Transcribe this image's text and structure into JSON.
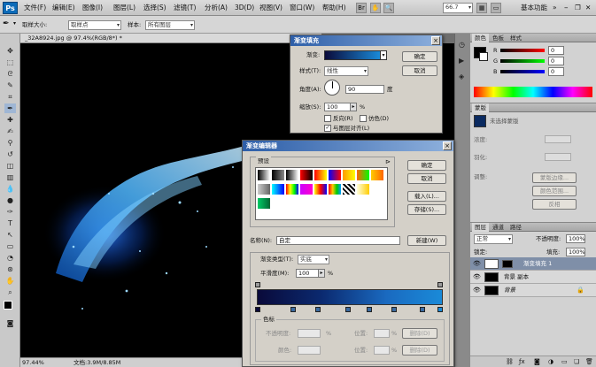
{
  "app": {
    "logo": "Ps"
  },
  "menubar": {
    "items": [
      "文件(F)",
      "编辑(E)",
      "图像(I)",
      "图层(L)",
      "选择(S)",
      "滤镜(T)",
      "分析(A)",
      "3D(D)",
      "视图(V)",
      "窗口(W)",
      "帮助(H)"
    ],
    "zoom": "66.7",
    "workspace": "基本功能"
  },
  "options": {
    "sample_size_label": "取样大小:",
    "sample_size_value": "取样点",
    "sample_label": "样本:",
    "sample_value": "所有图层"
  },
  "document": {
    "tab_title": "_32A8924.jpg @ 97.4%(RGB/8*) *",
    "status_zoom": "97.44%",
    "status_doc": "文档:3.9M/8.85M"
  },
  "gradient_fill": {
    "title": "渐变填充",
    "gradient_label": "渐变:",
    "style_label": "样式(T):",
    "style_value": "线性",
    "angle_label": "角度(A):",
    "angle_value": "90",
    "angle_unit": "度",
    "scale_label": "缩放(S):",
    "scale_value": "100",
    "scale_unit": "%",
    "reverse_label": "反向(R)",
    "dither_label": "仿色(D)",
    "align_label": "与图层对齐(L)",
    "ok": "确定",
    "cancel": "取消"
  },
  "gradient_editor": {
    "title": "渐变编辑器",
    "presets_label": "预设",
    "ok": "确定",
    "cancel": "取消",
    "load": "载入(L)...",
    "save": "存储(S)...",
    "name_label": "名称(N):",
    "name_value": "自定",
    "new_button": "新建(W)",
    "type_label": "渐变类型(T):",
    "type_value": "实底",
    "smoothness_label": "平滑度(M):",
    "smoothness_value": "100",
    "smoothness_unit": "%",
    "stops_group": "色标",
    "opacity_label": "不透明度:",
    "location_label": "位置:",
    "delete_label": "删除(D)",
    "color_label": "颜色:",
    "pct": "%"
  },
  "color_panel": {
    "tabs": [
      "颜色",
      "色板",
      "样式"
    ],
    "values": [
      "0",
      "0",
      "0"
    ],
    "channels": [
      "R",
      "G",
      "B"
    ]
  },
  "adjust_panel": {
    "tabs": [
      "蒙版"
    ],
    "mask_title": "未选择蒙版",
    "density_label": "浓度:",
    "feather_label": "羽化:",
    "refine_label": "调整:",
    "edge_btn": "蒙版边缘...",
    "color_range_btn": "颜色范围...",
    "invert_btn": "反相"
  },
  "layers_panel": {
    "tabs": [
      "图层",
      "通道",
      "路径"
    ],
    "blend_mode": "正常",
    "opacity_label": "不透明度:",
    "opacity_value": "100%",
    "fill_label": "填充:",
    "fill_value": "100%",
    "lock_label": "锁定:",
    "layers": [
      {
        "name": "渐变填充 1"
      },
      {
        "name": "背景 副本"
      },
      {
        "name": "背景"
      }
    ]
  },
  "colors": {
    "gradient_start": "#0a0a3a",
    "gradient_end": "#1a8ad8",
    "accent": "#2d5ea8"
  }
}
